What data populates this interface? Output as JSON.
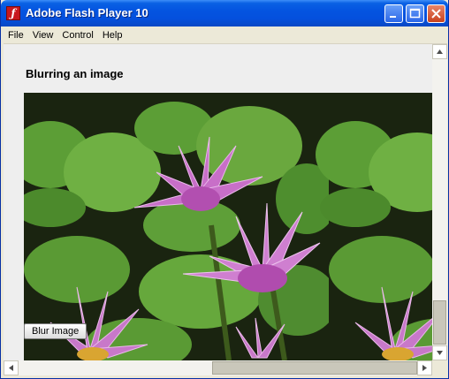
{
  "window": {
    "title": "Adobe Flash Player 10",
    "icon": "flash-icon"
  },
  "menu": {
    "items": [
      "File",
      "View",
      "Control",
      "Help"
    ]
  },
  "content": {
    "heading": "Blurring an image",
    "button_label": "Blur Image",
    "image": "water-lily-photo"
  },
  "colors": {
    "titlebar": "#0454e0",
    "content_bg": "#eeeeee",
    "leaf": "#5aa33a",
    "petal": "#c86fc8"
  }
}
